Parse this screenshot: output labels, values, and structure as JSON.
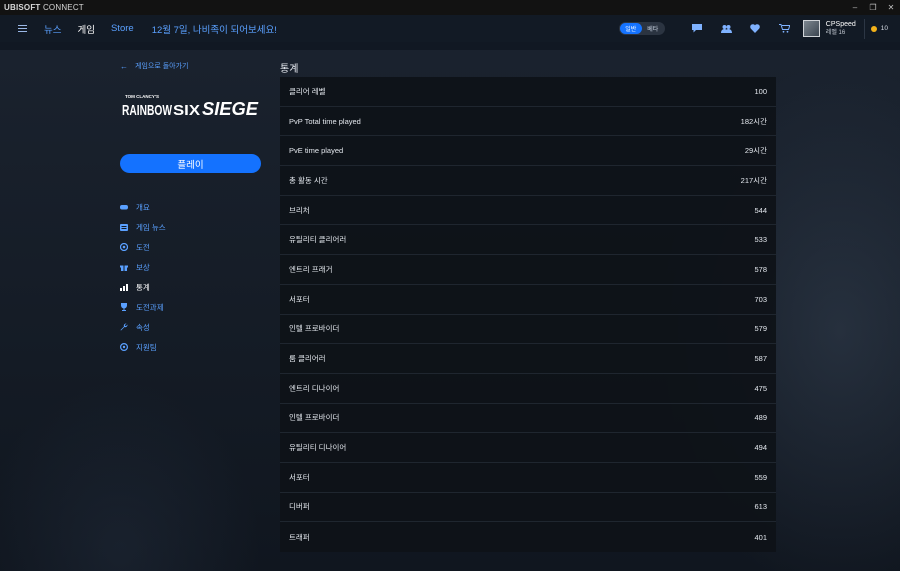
{
  "app": {
    "title_bold": "UBISOFT",
    "title_rest": " CONNECT"
  },
  "window_controls": [
    "–",
    "❐",
    "✕"
  ],
  "nav": {
    "tabs": [
      {
        "label": "뉴스",
        "active": false
      },
      {
        "label": "게임",
        "active": true
      },
      {
        "label": "Store",
        "active": false
      }
    ],
    "promo": "12월 7일, 나비족이 되어보세요!",
    "toggle": {
      "on": "일반",
      "off": "베타"
    },
    "icons": [
      "chat-icon",
      "friends-icon",
      "wishlist-icon",
      "cart-icon"
    ],
    "user": {
      "name": "CPSpeed",
      "level": "레벨 16"
    },
    "coins": "10",
    "accent": "#1573ff",
    "link_color": "#5aa0ff"
  },
  "sidebar": {
    "back_label": "게임으로 돌아가기",
    "logo": {
      "top_text": "TOM CLANCY'S",
      "name_left": "RAINBOW",
      "name_mid": "SIX",
      "name_right": "SIEGE"
    },
    "play_label": "플레이",
    "items": [
      {
        "label": "개요",
        "icon": "gamepad-icon",
        "active": false
      },
      {
        "label": "게임 뉴스",
        "icon": "news-icon",
        "active": false
      },
      {
        "label": "도전",
        "icon": "challenge-icon",
        "active": false
      },
      {
        "label": "보상",
        "icon": "gift-icon",
        "active": false
      },
      {
        "label": "통계",
        "icon": "stats-icon",
        "active": true
      },
      {
        "label": "도전과제",
        "icon": "trophy-icon",
        "active": false
      },
      {
        "label": "속성",
        "icon": "wrench-icon",
        "active": false
      },
      {
        "label": "지원팀",
        "icon": "support-icon",
        "active": false
      }
    ]
  },
  "stats": {
    "title": "통계",
    "rows": [
      {
        "label": "클리어 레벨",
        "value": "100"
      },
      {
        "label": "PvP Total time played",
        "value": "182시간"
      },
      {
        "label": "PvE time played",
        "value": "29시간"
      },
      {
        "label": "총 활동 시간",
        "value": "217시간"
      },
      {
        "label": "브리처",
        "value": "544"
      },
      {
        "label": "유틸리티 클리어러",
        "value": "533"
      },
      {
        "label": "엔트리 프래거",
        "value": "578"
      },
      {
        "label": "서포터",
        "value": "703"
      },
      {
        "label": "인텔 프로바이더",
        "value": "579"
      },
      {
        "label": "룸 클리어러",
        "value": "587"
      },
      {
        "label": "엔트리 디나이어",
        "value": "475"
      },
      {
        "label": "인텔 프로바이더",
        "value": "489"
      },
      {
        "label": "유틸리티 디나이어",
        "value": "494"
      },
      {
        "label": "서포터",
        "value": "559"
      },
      {
        "label": "디버퍼",
        "value": "613"
      },
      {
        "label": "트래퍼",
        "value": "401"
      }
    ]
  }
}
